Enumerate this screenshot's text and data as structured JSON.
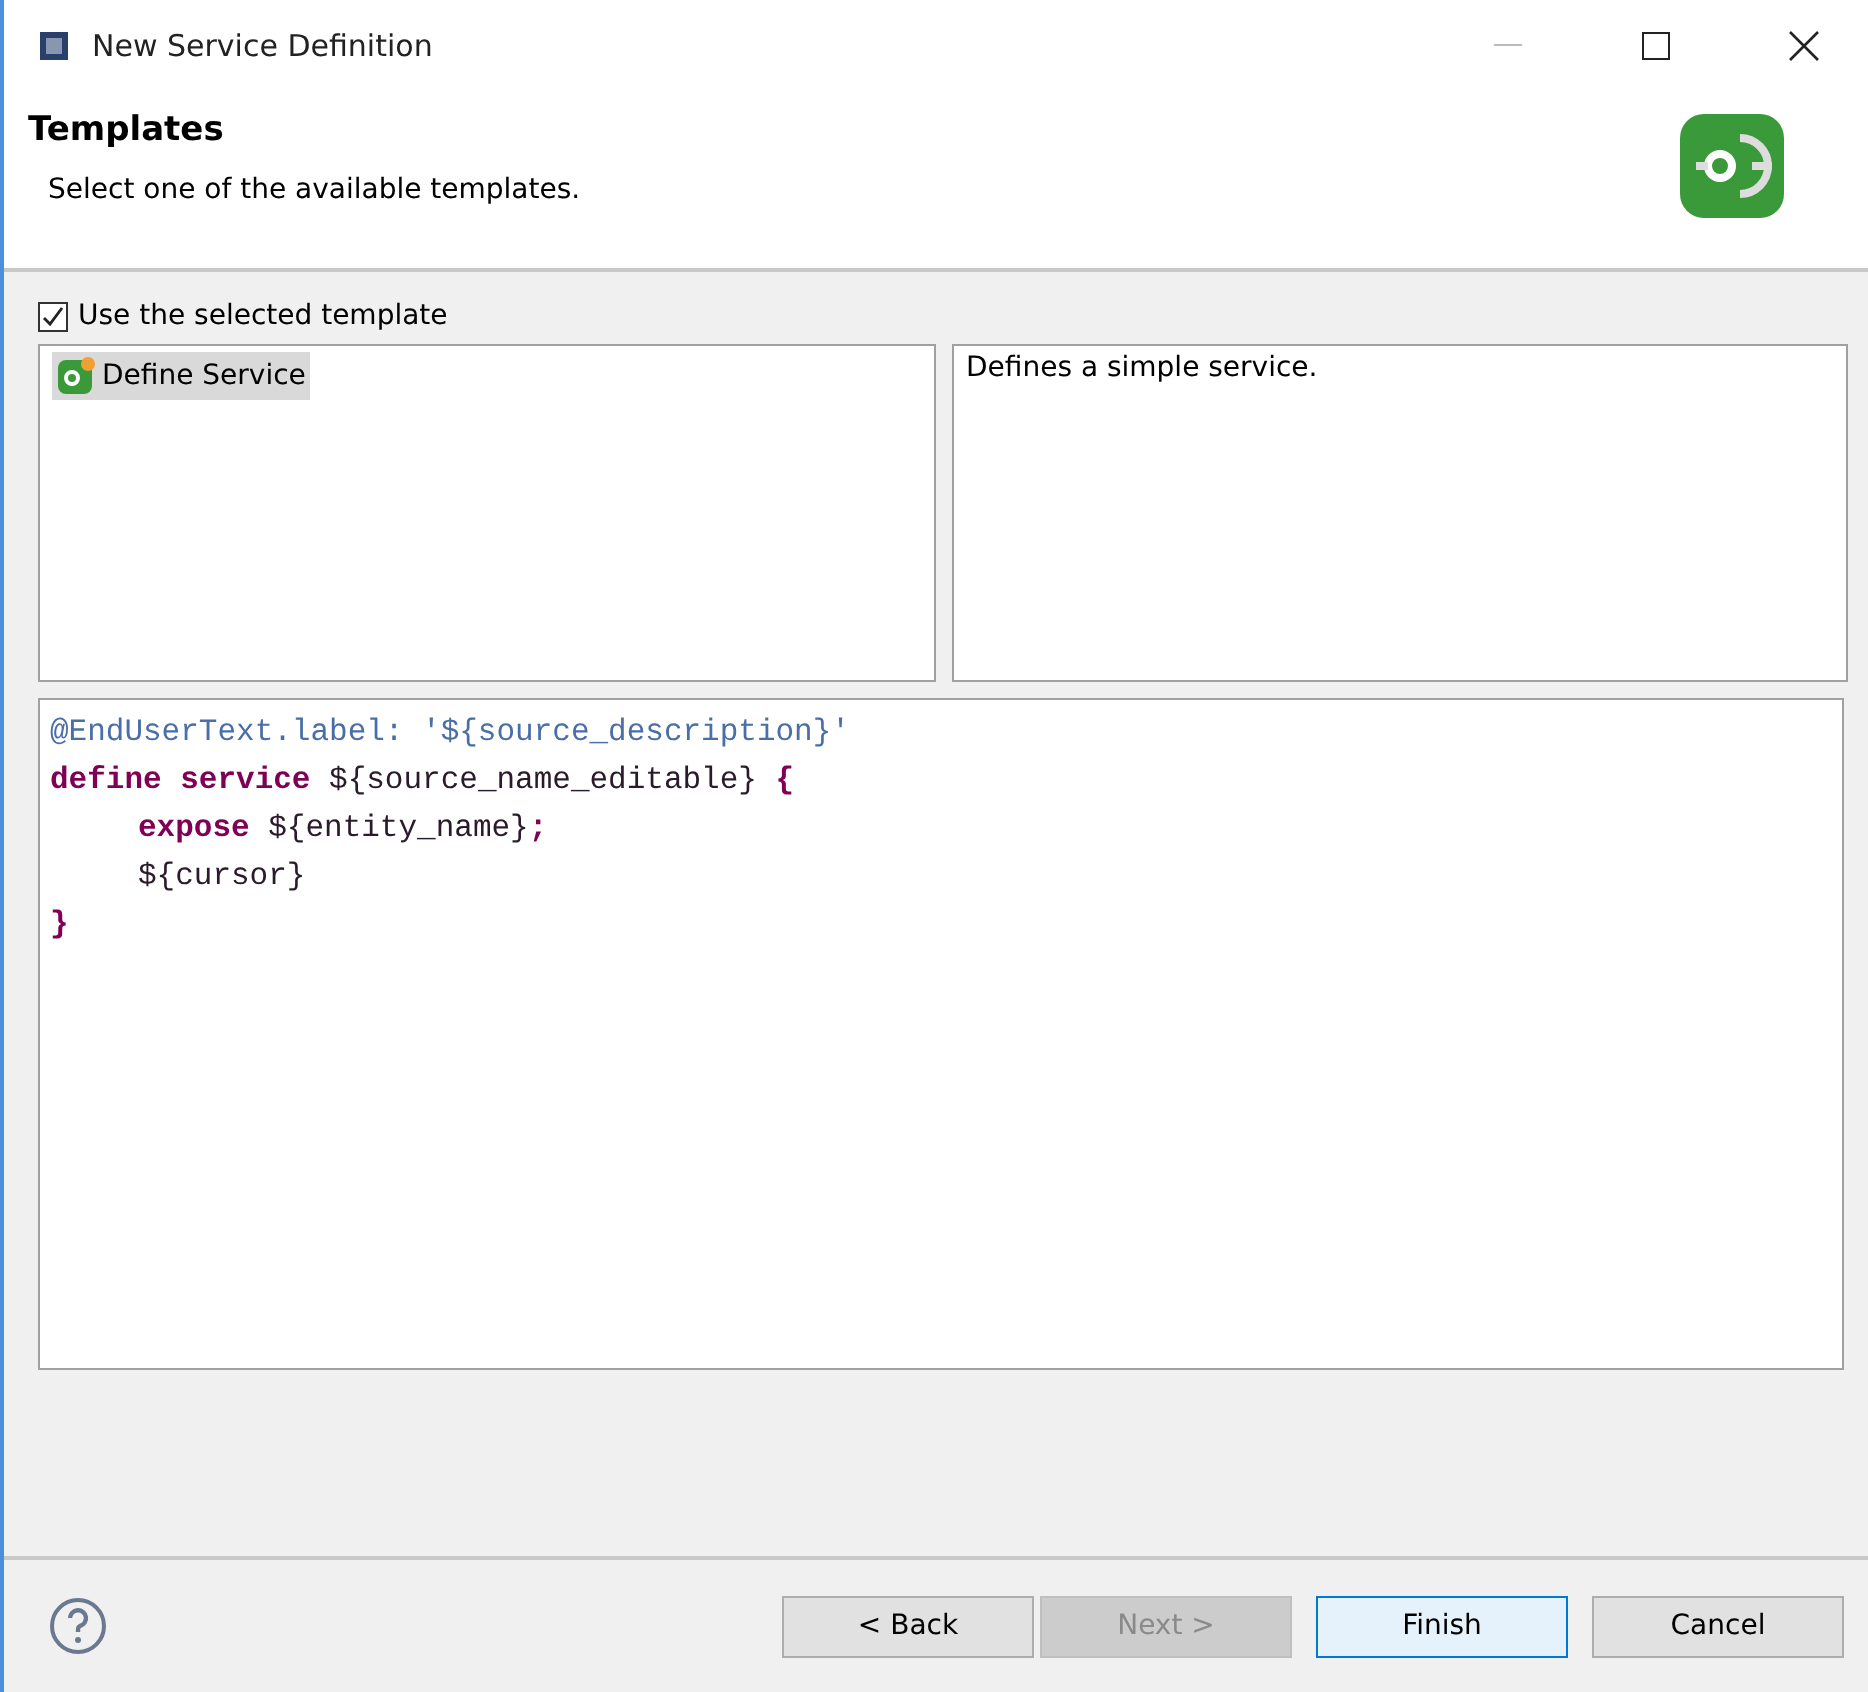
{
  "window": {
    "title": "New Service Definition"
  },
  "header": {
    "title": "Templates",
    "description": "Select one of the available templates."
  },
  "use_template": {
    "label": "Use the selected template",
    "checked": true
  },
  "templates": [
    {
      "label": "Define Service",
      "selected": true
    }
  ],
  "template_description": "Defines a simple service.",
  "code": [
    {
      "indented": false,
      "tokens": [
        {
          "kind": "annotation",
          "text": "@EndUserText.label: '${source_description}'"
        }
      ]
    },
    {
      "indented": false,
      "tokens": [
        {
          "kind": "keyword",
          "text": "define service "
        },
        {
          "kind": "plain",
          "text": "${source_name_editable}"
        },
        {
          "kind": "keyword",
          "text": " {"
        }
      ]
    },
    {
      "indented": true,
      "tokens": [
        {
          "kind": "keyword",
          "text": "expose "
        },
        {
          "kind": "plain",
          "text": "${entity_name}"
        },
        {
          "kind": "keyword",
          "text": ";"
        }
      ]
    },
    {
      "indented": true,
      "tokens": [
        {
          "kind": "plain",
          "text": "${cursor}"
        }
      ]
    },
    {
      "indented": false,
      "tokens": [
        {
          "kind": "keyword",
          "text": "}"
        }
      ]
    }
  ],
  "buttons": [
    {
      "label": "< Back",
      "disabled": false,
      "focused": false
    },
    {
      "label": "Next >",
      "disabled": true,
      "focused": false
    },
    {
      "label": "Finish",
      "disabled": false,
      "focused": true
    },
    {
      "label": "Cancel",
      "disabled": false,
      "focused": false
    }
  ]
}
